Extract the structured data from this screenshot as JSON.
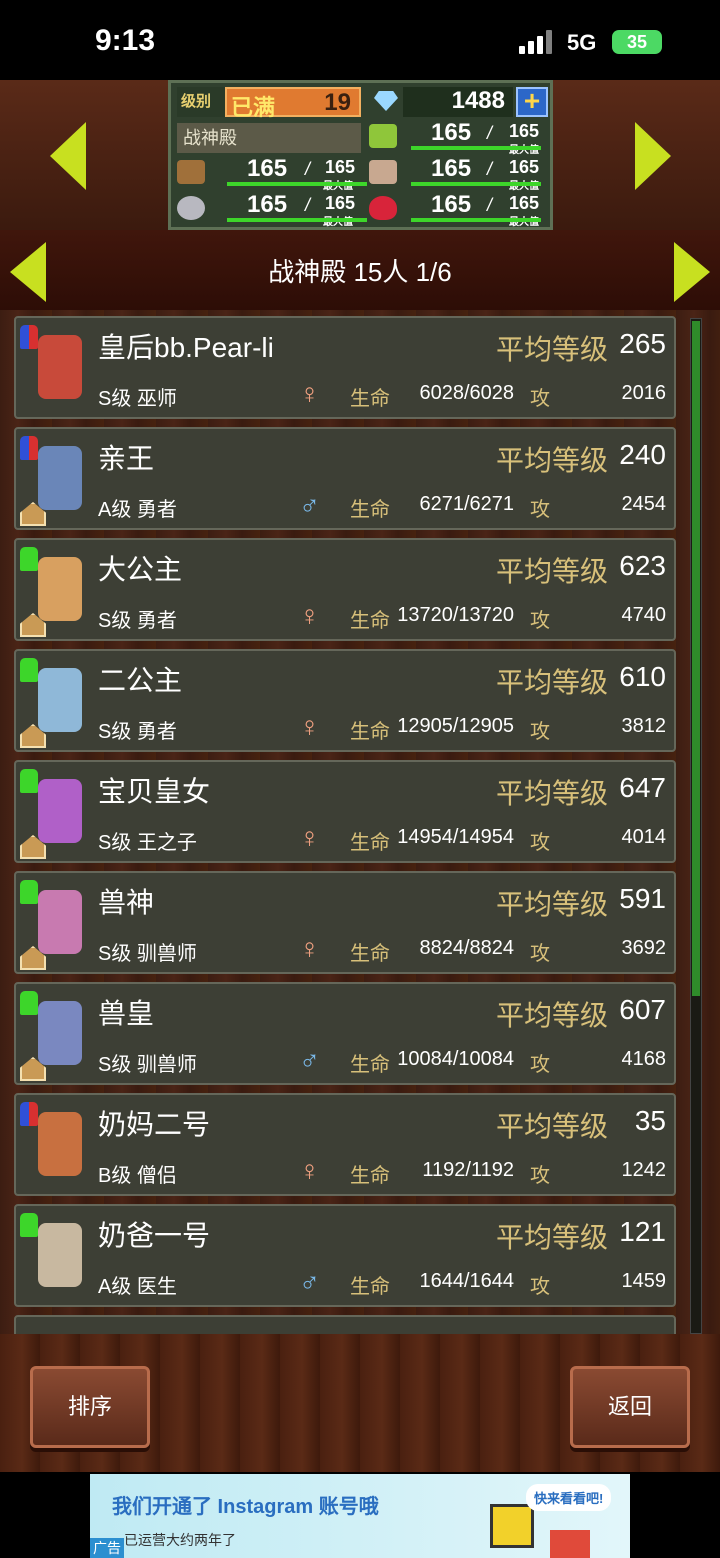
{
  "status_bar": {
    "time": "9:13",
    "network": "5G",
    "battery": "35"
  },
  "stats": {
    "level_label": "级别",
    "level_status": "已满",
    "level_value": "19",
    "gems": "1488",
    "facility": "战神殿",
    "resources": [
      {
        "icon": "grass-icon",
        "value": "165",
        "max": "165",
        "caption": "最大值"
      },
      {
        "icon": "wood-icon",
        "value": "165",
        "max": "165",
        "caption": "最大值"
      },
      {
        "icon": "food-icon",
        "value": "165",
        "max": "165",
        "caption": "最大值"
      },
      {
        "icon": "stone-icon",
        "value": "165",
        "max": "165",
        "caption": "最大值"
      },
      {
        "icon": "ruby-icon",
        "value": "165",
        "max": "165",
        "caption": "最大值"
      }
    ],
    "slash": "/"
  },
  "header": {
    "title": "战神殿  15人  1/6"
  },
  "labels": {
    "avg_level": "平均等级",
    "hp": "生命",
    "atk": "攻"
  },
  "heroes": [
    {
      "name": "皇后bb.Pear-li",
      "avg": "265",
      "rank_job": "S级 巫师",
      "gender": "female",
      "hp": "6028/6028",
      "atk": "2016",
      "badge": "blue-red",
      "house": false
    },
    {
      "name": "亲王",
      "avg": "240",
      "rank_job": "A级 勇者",
      "gender": "male",
      "hp": "6271/6271",
      "atk": "2454",
      "badge": "blue-red",
      "house": true
    },
    {
      "name": "大公主",
      "avg": "623",
      "rank_job": "S级 勇者",
      "gender": "female",
      "hp": "13720/13720",
      "atk": "4740",
      "badge": "green",
      "house": true
    },
    {
      "name": "二公主",
      "avg": "610",
      "rank_job": "S级 勇者",
      "gender": "female",
      "hp": "12905/12905",
      "atk": "3812",
      "badge": "green",
      "house": true
    },
    {
      "name": "宝贝皇女",
      "avg": "647",
      "rank_job": "S级 王之子",
      "gender": "female",
      "hp": "14954/14954",
      "atk": "4014",
      "badge": "green",
      "house": true
    },
    {
      "name": "兽神",
      "avg": "591",
      "rank_job": "S级 驯兽师",
      "gender": "female",
      "hp": "8824/8824",
      "atk": "3692",
      "badge": "green",
      "house": true
    },
    {
      "name": "兽皇",
      "avg": "607",
      "rank_job": "S级 驯兽师",
      "gender": "male",
      "hp": "10084/10084",
      "atk": "4168",
      "badge": "green",
      "house": true
    },
    {
      "name": "奶妈二号",
      "avg": "35",
      "rank_job": "B级 僧侣",
      "gender": "female",
      "hp": "1192/1192",
      "atk": "1242",
      "badge": "blue-red",
      "house": false
    },
    {
      "name": "奶爸一号",
      "avg": "121",
      "rank_job": "A级 医生",
      "gender": "male",
      "hp": "1644/1644",
      "atk": "1459",
      "badge": "green",
      "house": false
    }
  ],
  "buttons": {
    "sort": "排序",
    "back": "返回"
  },
  "ad": {
    "title": "我们开通了 Instagram 账号哦",
    "subtitle": "已运营大约两年了",
    "tag": "广告",
    "bubble": "快来看看吧!"
  }
}
